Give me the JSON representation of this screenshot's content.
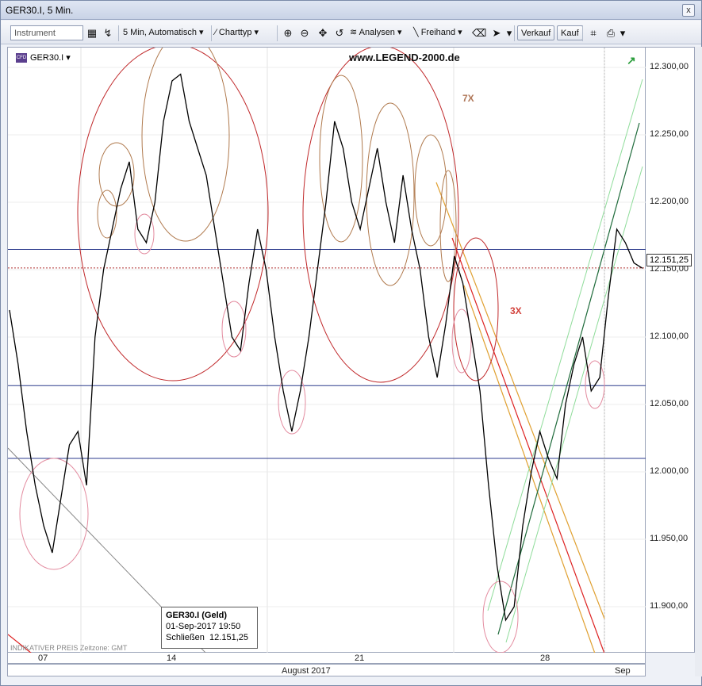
{
  "window": {
    "title": "GER30.I, 5 Min.",
    "close_glyph": "x"
  },
  "toolbar": {
    "instrument_placeholder": "Instrument",
    "interval": "5 Min,",
    "scale": "Automatisch",
    "charttyp": "Charttyp",
    "analysen": "Analysen",
    "freihand": "Freihand",
    "verkauf": "Verkauf",
    "kauf": "Kauf"
  },
  "chart": {
    "symbol": "GER30.I",
    "symbol_badge": "CFD",
    "watermark": "www.LEGEND-2000.de",
    "annotation_7x": "7X",
    "annotation_3x": "3X",
    "indicator_text": "INDIKATIVER PREIS   Zeitzone: GMT",
    "current_price": "12.151,25",
    "tooltip": {
      "title": "GER30.I (Geld)",
      "datetime": "01-Sep-2017 19:50",
      "close_label": "Schließen",
      "close_value": "12.151,25"
    },
    "colors": {
      "price_line": "#000000",
      "ellipse_red": "#c0282a",
      "ellipse_brown": "#b07a4e",
      "ellipse_pink": "#e38b9f",
      "hline": "#2b3a8c",
      "channel_green": "#1f6b3b"
    }
  },
  "chart_data": {
    "type": "line",
    "title": "GER30.I, 5 Min.",
    "ylim": [
      11870,
      12310
    ],
    "y_ticks": [
      "12.300,00",
      "12.250,00",
      "12.200,00",
      "12.150,00",
      "12.100,00",
      "12.050,00",
      "12.000,00",
      "11.950,00",
      "11.900,00"
    ],
    "x_ticks": [
      "07",
      "14",
      "21",
      "28"
    ],
    "month_labels": [
      "August 2017",
      "Sep"
    ],
    "horizontal_levels": [
      12165,
      12064,
      12010
    ],
    "series": [
      {
        "values": [
          12120,
          12080,
          12030,
          11990,
          11960,
          11940,
          11980,
          12020,
          12030,
          11990,
          12100,
          12150,
          12180,
          12210,
          12230,
          12180,
          12170,
          12200,
          12260,
          12290,
          12295,
          12260,
          12240,
          12220,
          12180,
          12140,
          12100,
          12090,
          12140,
          12180,
          12150,
          12100,
          12060,
          12030,
          12060,
          12100,
          12150,
          12200,
          12260,
          12240,
          12200,
          12180,
          12210,
          12240,
          12200,
          12170,
          12220,
          12180,
          12150,
          12100,
          12070,
          12110,
          12160,
          12140,
          12100,
          12060,
          11990,
          11930,
          11890,
          11900,
          11960,
          12000,
          12030,
          12010,
          11995,
          12050,
          12080,
          12100,
          12060,
          12070,
          12130,
          12180,
          12170,
          12155,
          12151
        ]
      }
    ]
  }
}
